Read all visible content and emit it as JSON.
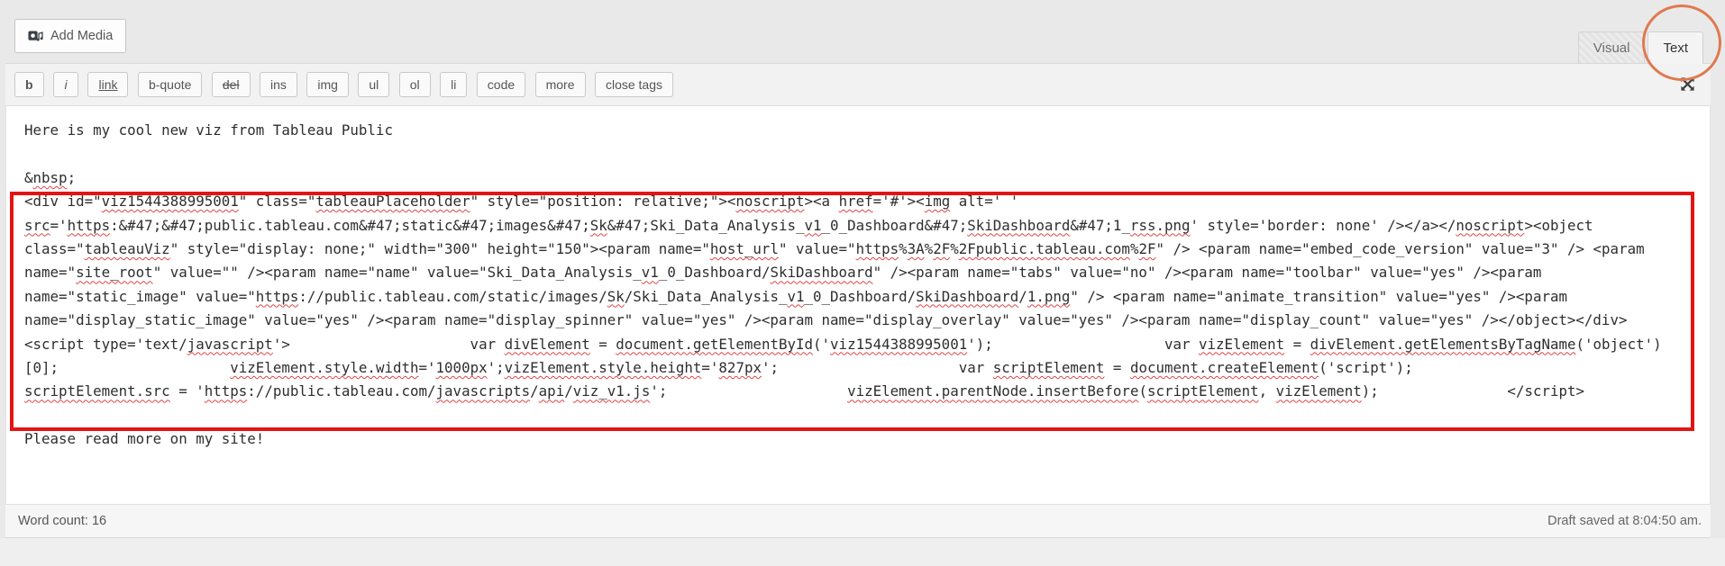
{
  "header": {
    "add_media_label": "Add Media",
    "tabs": {
      "visual": "Visual",
      "text": "Text"
    }
  },
  "toolbar": {
    "buttons": [
      "b",
      "i",
      "link",
      "b-quote",
      "del",
      "ins",
      "img",
      "ul",
      "ol",
      "li",
      "code",
      "more",
      "close tags"
    ]
  },
  "editor": {
    "intro_line": "Here is my cool new viz from Tableau Public",
    "nbsp_line": "&nbsp;",
    "code_lines": [
      "<div id=\"viz1544388995001\" class=\"tableauPlaceholder\" style=\"position: relative;\"><noscript><a href='#'><img alt=' '",
      "src='https:&#47;&#47;public.tableau.com&#47;static&#47;images&#47;Sk&#47;Ski_Data_Analysis_v1_0_Dashboard&#47;SkiDashboard&#47;1_rss.png' style='border: none' /></a></noscript><object",
      "class=\"tableauViz\" style=\"display: none;\" width=\"300\" height=\"150\"><param name=\"host_url\" value=\"https%3A%2F%2Fpublic.tableau.com%2F\" /> <param name=\"embed_code_version\" value=\"3\" /> <param",
      "name=\"site_root\" value=\"\" /><param name=\"name\" value=\"Ski_Data_Analysis_v1_0_Dashboard/SkiDashboard\" /><param name=\"tabs\" value=\"no\" /><param name=\"toolbar\" value=\"yes\" /><param",
      "name=\"static_image\" value=\"https://public.tableau.com/static/images/Sk/Ski_Data_Analysis_v1_0_Dashboard/SkiDashboard/1.png\" /> <param name=\"animate_transition\" value=\"yes\" /><param",
      "name=\"display_static_image\" value=\"yes\" /><param name=\"display_spinner\" value=\"yes\" /><param name=\"display_overlay\" value=\"yes\" /><param name=\"display_count\" value=\"yes\" /></object></div>",
      "<script type='text/javascript'>                     var divElement = document.getElementById('viz1544388995001');                    var vizElement = divElement.getElementsByTagName('object')",
      "[0];                    vizElement.style.width='1000px';vizElement.style.height='827px';                     var scriptElement = document.createElement('script');",
      "scriptElement.src = 'https://public.tableau.com/javascripts/api/viz_v1.js';                     vizElement.parentNode.insertBefore(scriptElement, vizElement);               </script>"
    ],
    "outro_line": "Please read more on my site!",
    "misspelled_tokens": [
      "viz1544388995001",
      "tableauPlaceholder",
      "noscript",
      "href",
      "img",
      "src",
      "https",
      "SkiDashboard",
      "rss.png",
      "tableauViz",
      "host_url",
      "3A",
      "2Fpublic.tableau.com",
      "2F",
      "site_root",
      "Sk",
      "v1",
      "1.png",
      "javascript",
      "divElement.getElementsByTagName",
      "document.getElementById",
      "divElement",
      "vizElement.style.width",
      "vizElement.style.height",
      "vizElement.parentNode.insertBefore",
      "vizElement",
      "1000px",
      "827px",
      "document.createElement",
      "scriptElement.src",
      "scriptElement",
      "javascripts",
      "api",
      "viz_v1.js",
      "nbsp"
    ]
  },
  "annotations": {
    "box_color": "#e41414",
    "circle_color": "#e0794f"
  },
  "footer": {
    "word_count_label": "Word count:",
    "word_count_value": "16",
    "draft_saved": "Draft saved at 8:04:50 am."
  }
}
